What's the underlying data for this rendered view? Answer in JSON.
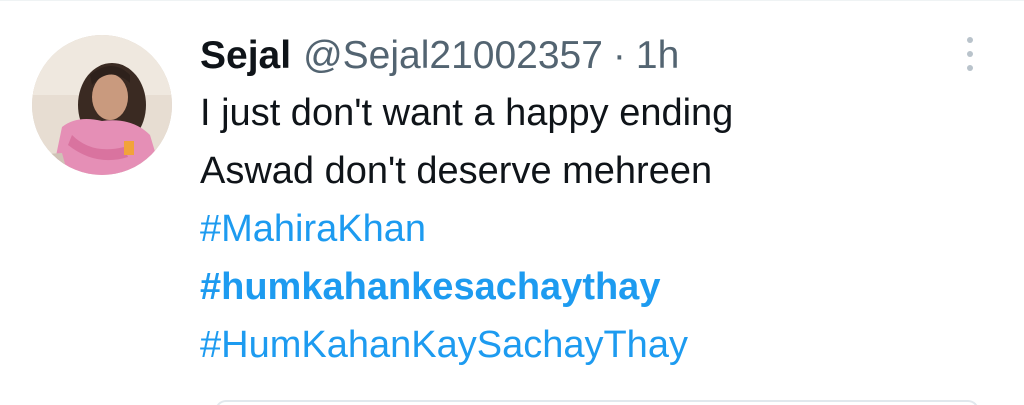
{
  "tweet": {
    "display_name": "Sejal",
    "handle": "@Sejal21002357",
    "separator": "·",
    "time": "1h",
    "lines": [
      "I just don't want a happy ending",
      "Aswad don't deserve mehreen"
    ],
    "hashtags": [
      "#MahiraKhan",
      "#humkahankesachaythay",
      "#HumKahanKaySachayThay"
    ],
    "more_icon": "more-vertical-icon",
    "colors": {
      "text": "#0f1419",
      "secondary": "#536471",
      "link": "#1d9bf0"
    }
  }
}
